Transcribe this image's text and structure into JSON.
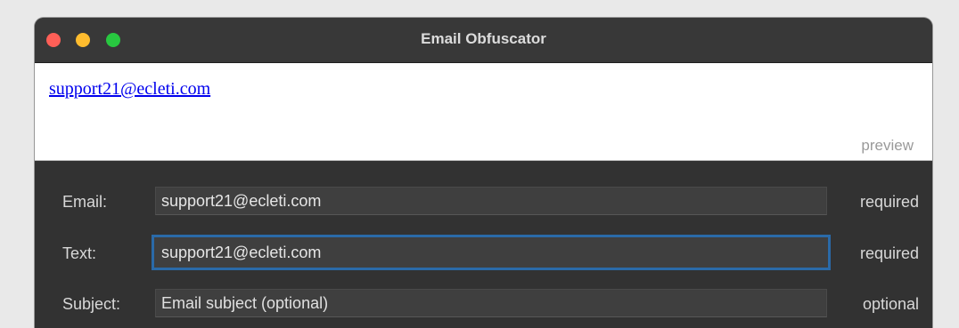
{
  "window": {
    "title": "Email Obfuscator"
  },
  "preview": {
    "link_text": "support21@ecleti.com",
    "caption": "preview"
  },
  "form": {
    "email": {
      "label": "Email:",
      "value": "support21@ecleti.com",
      "hint": "required"
    },
    "text": {
      "label": "Text:",
      "value": "support21@ecleti.com",
      "hint": "required"
    },
    "subject": {
      "label": "Subject:",
      "value": "",
      "placeholder": "Email subject (optional)",
      "hint": "optional"
    }
  },
  "colors": {
    "close": "#ff5f57",
    "minimize": "#febc2e",
    "zoom": "#28c840",
    "focus_ring": "#2a6aa8",
    "link": "#0000ee"
  }
}
